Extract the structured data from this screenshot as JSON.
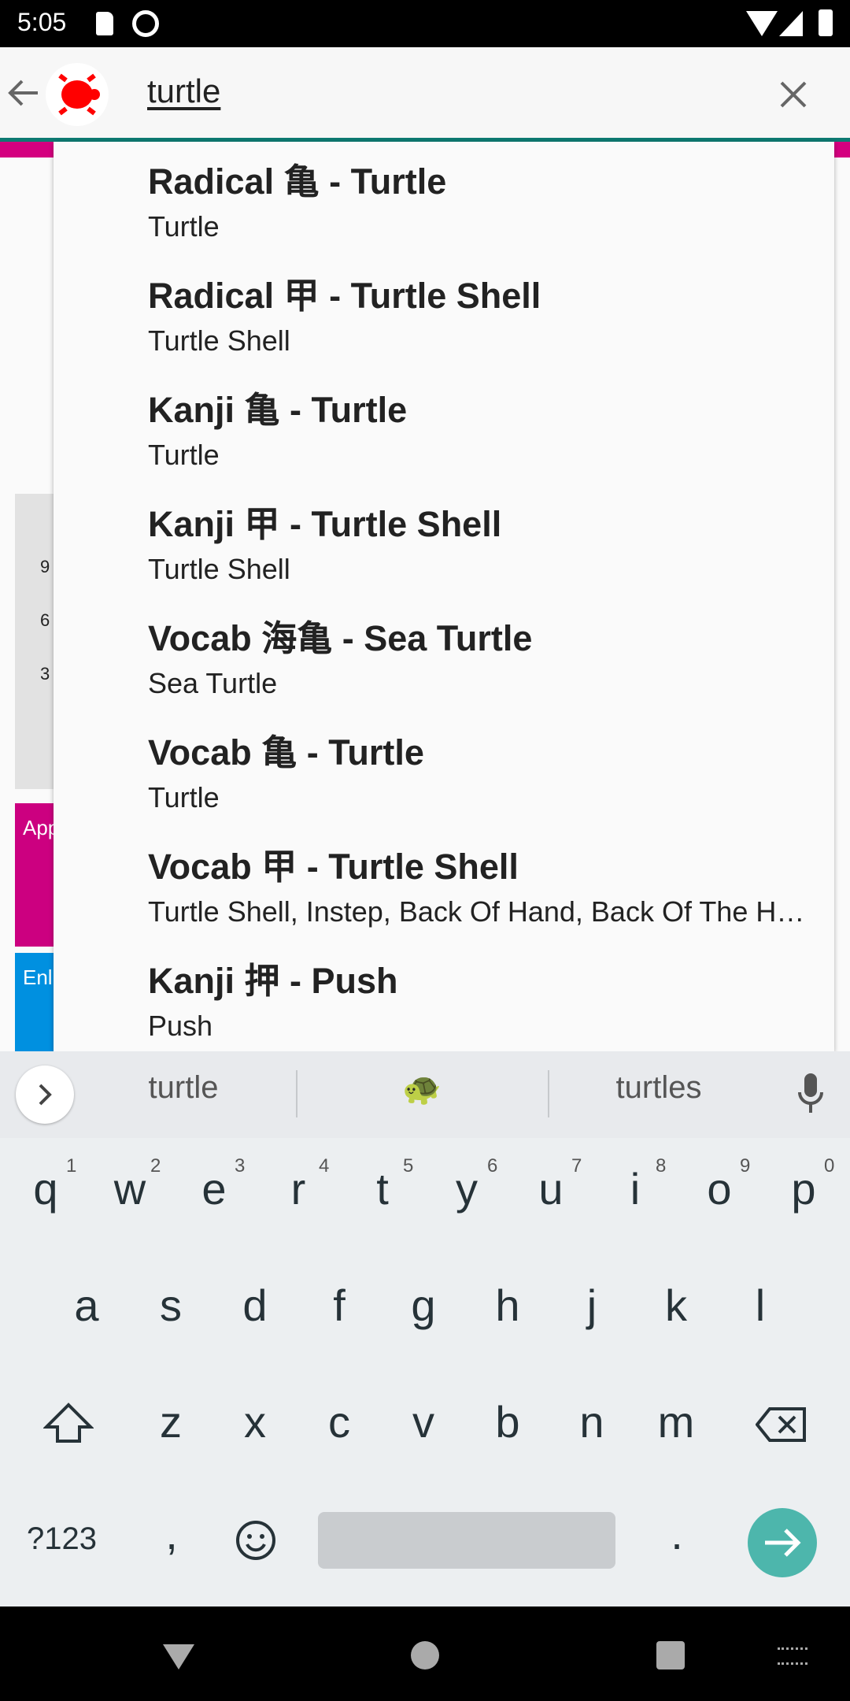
{
  "status_bar": {
    "time": "5:05"
  },
  "app_bar": {
    "query": "turtle"
  },
  "background": {
    "ticks": [
      "9",
      "6",
      "3"
    ],
    "tile1": "App",
    "tile2": "Enl"
  },
  "results": [
    {
      "title": "Radical 亀 - Turtle",
      "subtitle": "Turtle"
    },
    {
      "title": "Radical 甲 - Turtle Shell",
      "subtitle": "Turtle Shell"
    },
    {
      "title": "Kanji 亀 - Turtle",
      "subtitle": "Turtle"
    },
    {
      "title": "Kanji 甲 - Turtle Shell",
      "subtitle": "Turtle Shell"
    },
    {
      "title": "Vocab 海亀 - Sea Turtle",
      "subtitle": "Sea Turtle"
    },
    {
      "title": "Vocab 亀 - Turtle",
      "subtitle": "Turtle"
    },
    {
      "title": "Vocab 甲 - Turtle Shell",
      "subtitle": "Turtle Shell, Instep, Back Of Hand, Back Of The Head"
    },
    {
      "title": "Kanji 押 - Push",
      "subtitle": "Push"
    }
  ],
  "keyboard": {
    "suggestions": [
      "turtle",
      "🐢",
      "turtles"
    ],
    "row1": [
      "q",
      "w",
      "e",
      "r",
      "t",
      "y",
      "u",
      "i",
      "o",
      "p"
    ],
    "row1_nums": [
      "1",
      "2",
      "3",
      "4",
      "5",
      "6",
      "7",
      "8",
      "9",
      "0"
    ],
    "row2": [
      "a",
      "s",
      "d",
      "f",
      "g",
      "h",
      "j",
      "k",
      "l"
    ],
    "row3": [
      "z",
      "x",
      "c",
      "v",
      "b",
      "n",
      "m"
    ],
    "symbols": "?123",
    "comma": ",",
    "period": ".",
    "accent": "#4db6ac"
  },
  "colors": {
    "teal": "#0e7a72",
    "magenta": "#d4007f",
    "blue": "#0090e0",
    "logo": "#ff0000"
  }
}
